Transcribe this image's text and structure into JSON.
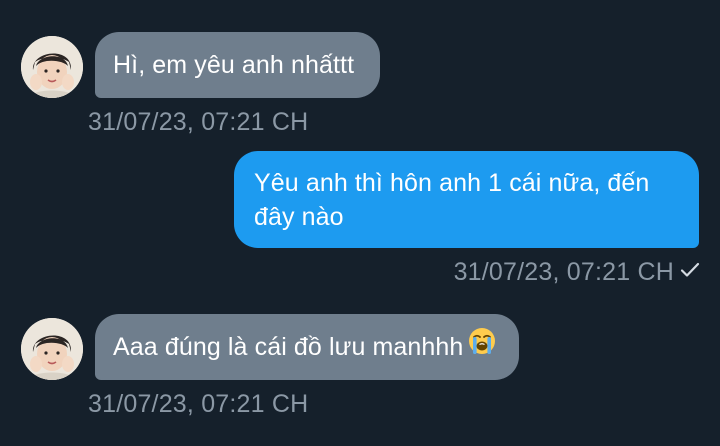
{
  "messages": [
    {
      "direction": "incoming",
      "text": "Hì, em yêu anh nhấttt",
      "timestamp": "31/07/23, 07:21 CH"
    },
    {
      "direction": "outgoing",
      "text_line1": "Yêu anh thì hôn anh 1 cái nữa, đến",
      "text_line2": "đây nào",
      "timestamp": "31/07/23, 07:21 CH",
      "status_icon": "check-icon"
    },
    {
      "direction": "incoming",
      "text": "Aaa đúng là cái đồ lưu manhhh",
      "emoji": "😭",
      "emoji_name": "loudly-crying-face-icon",
      "timestamp": "31/07/23, 07:21 CH"
    }
  ],
  "colors": {
    "background": "#15202b",
    "incoming_bubble": "#6f7e8d",
    "outgoing_bubble": "#1d9bf0",
    "timestamp": "#8b98a5"
  }
}
